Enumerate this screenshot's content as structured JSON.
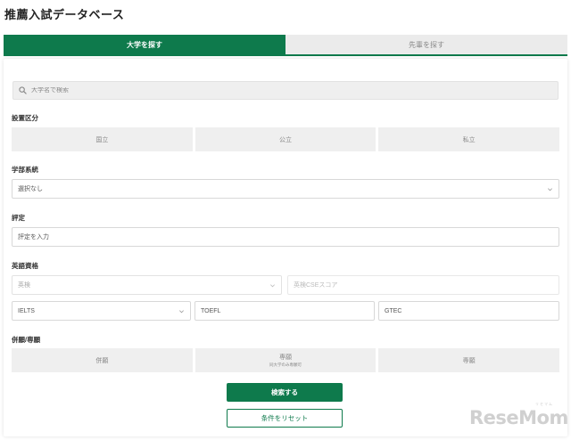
{
  "page_title": "推薦入試データベース",
  "tabs": [
    {
      "label": "大学を探す",
      "active": true
    },
    {
      "label": "先輩を探す",
      "active": false
    }
  ],
  "search": {
    "placeholder": "大学名で検索",
    "icon": "search-icon"
  },
  "setup_category": {
    "label": "設置区分",
    "options": [
      "国立",
      "公立",
      "私立"
    ]
  },
  "faculty": {
    "label": "学部系統",
    "value": "選択なし"
  },
  "rating": {
    "label": "評定",
    "placeholder": "評定を入力"
  },
  "english": {
    "label": "英語資格",
    "eiken_value": "英検",
    "eiken_cse_placeholder": "英検CSEスコア",
    "ielts_value": "IELTS",
    "toefl_placeholder": "TOEFL",
    "gtec_placeholder": "GTEC"
  },
  "application": {
    "label": "併願/専願",
    "options": [
      {
        "label": "併願",
        "sub": ""
      },
      {
        "label": "専願",
        "sub": "同大学のみ専願可"
      },
      {
        "label": "専願",
        "sub": ""
      }
    ]
  },
  "actions": {
    "search_label": "検索する",
    "reset_label": "条件をリセット"
  },
  "watermark": {
    "text": "ReseMom",
    "ruby": "リセマム"
  },
  "colors": {
    "accent": "#0e7a4c",
    "inactive_tab": "#ebebeb",
    "button_bg": "#efefef"
  }
}
